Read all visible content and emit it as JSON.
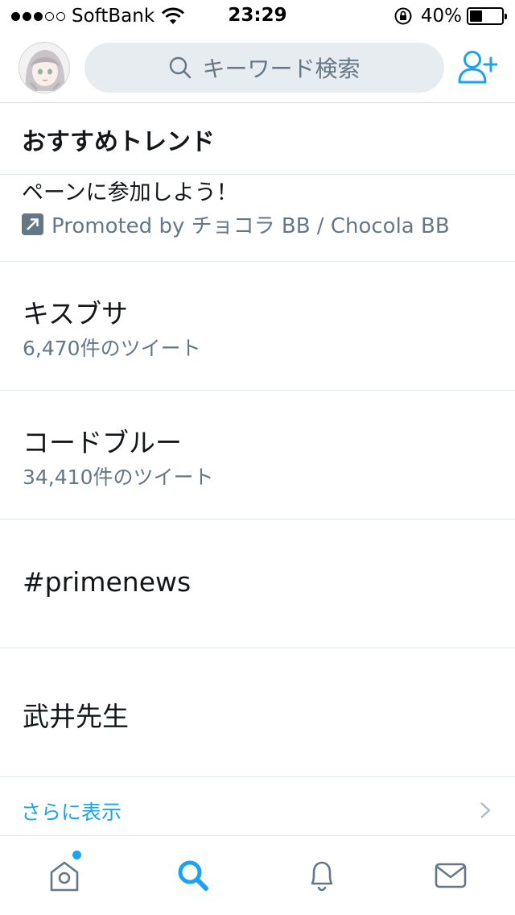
{
  "status_bar": {
    "carrier": "SoftBank",
    "time": "23:29",
    "battery_percent": "40%",
    "battery_level": 0.4,
    "signal_bars": 3,
    "signal_total": 5
  },
  "header": {
    "search_placeholder": "キーワード検索",
    "avatar_icon": "avatar",
    "add_user_icon": "add-user-icon"
  },
  "trends": {
    "title": "おすすめトレンド",
    "promoted": {
      "text": "ペーンに参加しよう！",
      "by": "Promoted by チョコラ BB / Chocola BB",
      "icon": "promoted-arrow-icon"
    },
    "items": [
      {
        "name": "キスブサ",
        "count": "6,470件のツイート"
      },
      {
        "name": "コードブルー",
        "count": "34,410件のツイート"
      },
      {
        "name": "#primenews",
        "count": ""
      },
      {
        "name": "武井先生",
        "count": ""
      }
    ],
    "show_more": "さらに表示"
  },
  "tab_bar": {
    "tabs": [
      "home-icon",
      "search-icon",
      "notifications-icon",
      "messages-icon"
    ],
    "active": "search-icon",
    "accent_color": "#1da1f2",
    "inactive_color": "#657786"
  }
}
